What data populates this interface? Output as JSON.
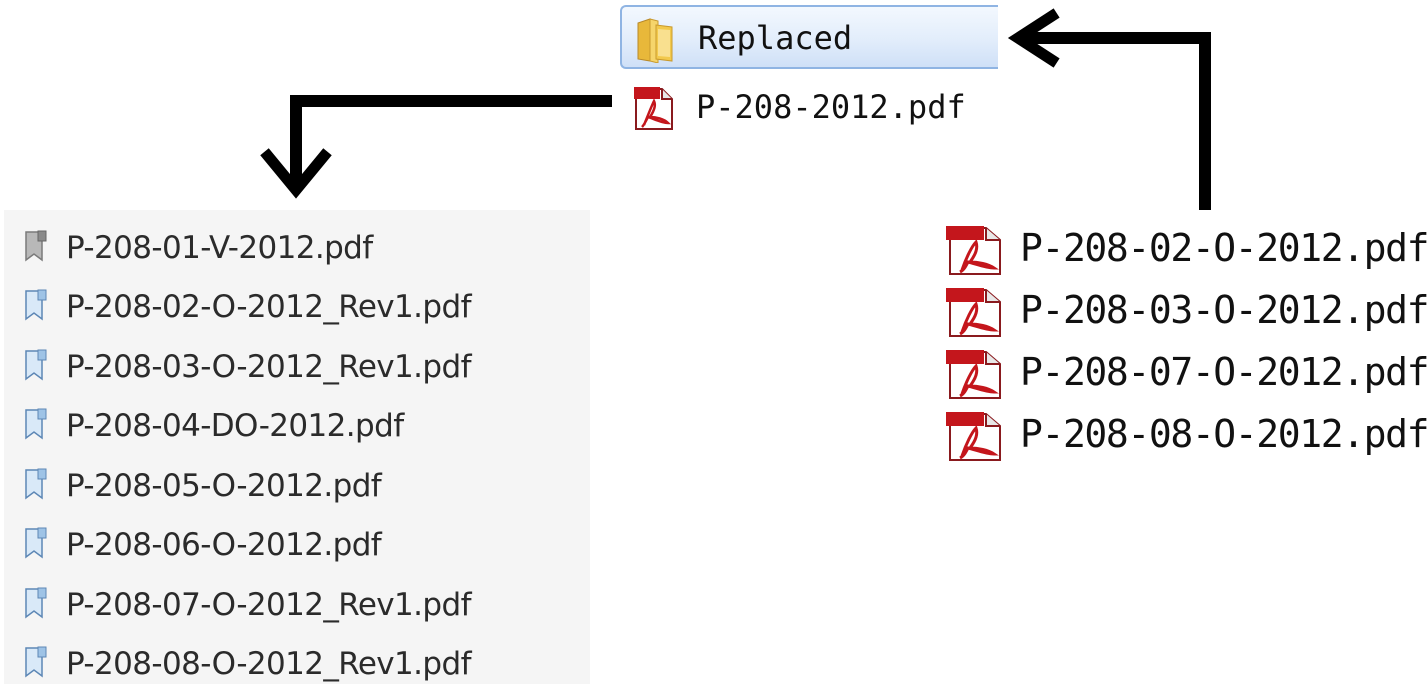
{
  "folder": {
    "label": "Replaced",
    "icon": "folder-icon"
  },
  "top_file": {
    "name": "P-208-2012.pdf",
    "icon": "pdf-icon"
  },
  "left_files": [
    {
      "name": "P-208-01-V-2012.pdf",
      "icon": "bookmark-gray-icon"
    },
    {
      "name": "P-208-02-O-2012_Rev1.pdf",
      "icon": "bookmark-blue-icon"
    },
    {
      "name": "P-208-03-O-2012_Rev1.pdf",
      "icon": "bookmark-blue-icon"
    },
    {
      "name": "P-208-04-DO-2012.pdf",
      "icon": "bookmark-blue-icon"
    },
    {
      "name": "P-208-05-O-2012.pdf",
      "icon": "bookmark-blue-icon"
    },
    {
      "name": "P-208-06-O-2012.pdf",
      "icon": "bookmark-blue-icon"
    },
    {
      "name": "P-208-07-O-2012_Rev1.pdf",
      "icon": "bookmark-blue-icon"
    },
    {
      "name": "P-208-08-O-2012_Rev1.pdf",
      "icon": "bookmark-blue-icon"
    }
  ],
  "right_files": [
    {
      "name": "P-208-02-O-2012.pdf",
      "icon": "pdf-icon"
    },
    {
      "name": "P-208-03-O-2012.pdf",
      "icon": "pdf-icon"
    },
    {
      "name": "P-208-07-O-2012.pdf",
      "icon": "pdf-icon"
    },
    {
      "name": "P-208-08-O-2012.pdf",
      "icon": "pdf-icon"
    }
  ],
  "colors": {
    "pdf_red": "#c4161c",
    "folder_yellow": "#f2c94c",
    "selection_border": "#8fb4e3",
    "bookmark_blue": "#9ec3e6",
    "bookmark_gray": "#9a9a9a"
  }
}
